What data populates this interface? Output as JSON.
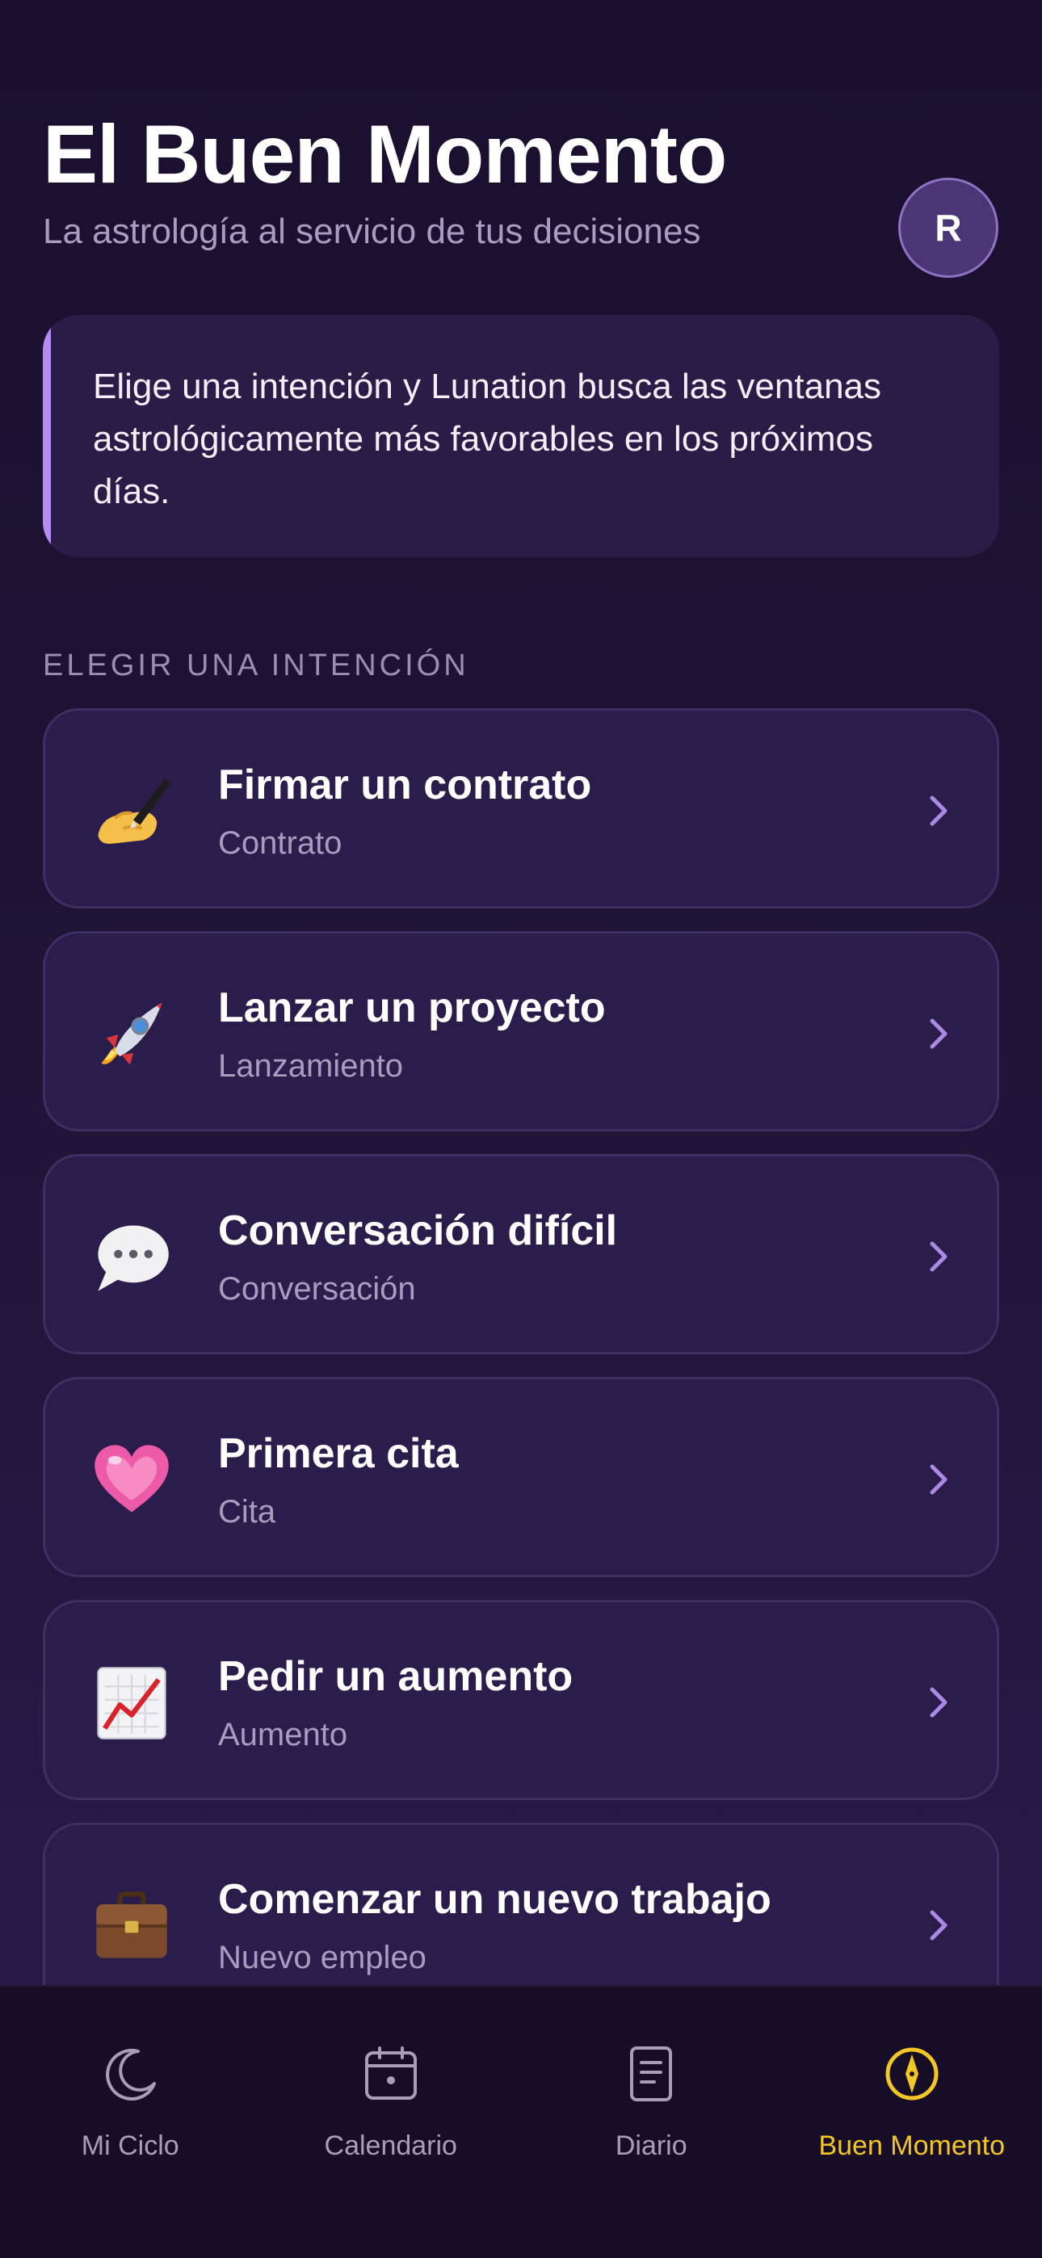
{
  "header": {
    "title": "El Buen Momento",
    "subtitle": "La astrología al servicio de tus decisiones",
    "avatar_initial": "R"
  },
  "info_card": {
    "text": "Elige una intención y Lunation busca las ventanas astrológicamente más favorables en los próximos días."
  },
  "section_label": "ELEGIR UNA INTENCIÓN",
  "intentions": [
    {
      "icon": "writing-hand-icon",
      "label": "Firmar un contrato",
      "sub": "Contrato"
    },
    {
      "icon": "rocket-icon",
      "label": "Lanzar un proyecto",
      "sub": "Lanzamiento"
    },
    {
      "icon": "speech-bubble-icon",
      "label": "Conversación difícil",
      "sub": "Conversación"
    },
    {
      "icon": "heart-icon",
      "label": "Primera cita",
      "sub": "Cita"
    },
    {
      "icon": "chart-increasing-icon",
      "label": "Pedir un aumento",
      "sub": "Aumento"
    },
    {
      "icon": "briefcase-icon",
      "label": "Comenzar un nuevo trabajo",
      "sub": "Nuevo empleo"
    }
  ],
  "tabbar": {
    "tabs": [
      {
        "icon": "moon-icon",
        "label": "Mi Ciclo"
      },
      {
        "icon": "calendar-icon",
        "label": "Calendario"
      },
      {
        "icon": "journal-icon",
        "label": "Diario"
      },
      {
        "icon": "compass-icon",
        "label": "Buen Momento"
      }
    ],
    "active_index": 3
  },
  "colors": {
    "background": "#1a0f2e",
    "card": "#2b1d4b",
    "accent_purple": "#b48cf2",
    "accent_yellow": "#f3c623",
    "chevron": "#a98be6"
  }
}
